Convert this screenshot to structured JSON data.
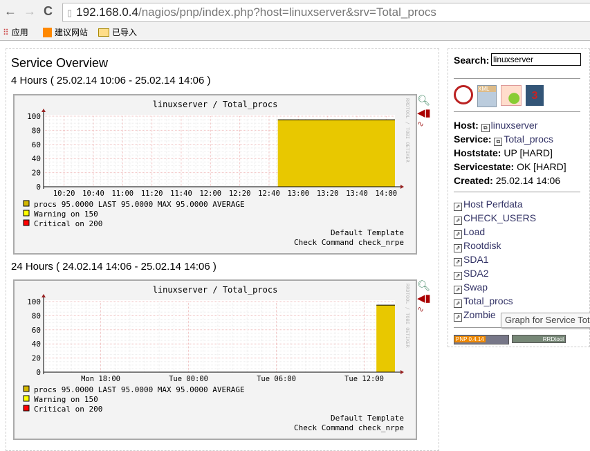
{
  "browser": {
    "url_host": "192.168.0.4",
    "url_path": "/nagios/pnp/index.php?host=linuxserver&srv=Total_procs",
    "bookmarks": [
      {
        "label": "应用",
        "icon": "apps-grid-icon"
      },
      {
        "label": "建议网站",
        "icon": "suggested-sites-icon"
      },
      {
        "label": "已导入",
        "icon": "folder-icon"
      }
    ]
  },
  "main": {
    "title": "Service Overview",
    "periods": [
      {
        "label": "4 Hours ( 25.02.14 10:06 - 25.02.14 14:06 )"
      },
      {
        "label": "24 Hours ( 24.02.14 14:06 - 25.02.14 14:06 )"
      }
    ]
  },
  "chart_data": [
    {
      "type": "area",
      "title": "linuxserver / Total_procs",
      "ylim": [
        0,
        100
      ],
      "yticks": [
        "0",
        "20",
        "40",
        "60",
        "80",
        "100"
      ],
      "xrange": [
        "10:06",
        "14:06"
      ],
      "xticks": [
        "10:20",
        "10:40",
        "11:00",
        "11:20",
        "11:40",
        "12:00",
        "12:20",
        "12:40",
        "13:00",
        "13:20",
        "13:40",
        "14:00"
      ],
      "series": [
        {
          "name": "procs",
          "from": "12:46",
          "to": "14:06",
          "value": 95,
          "color": "#e8c800"
        }
      ],
      "legend": [
        {
          "label": "procs    95.0000  LAST    95.0000  MAX    95.0000  AVERAGE",
          "color": "#d4b800"
        },
        {
          "label": "Warning on  150",
          "color": "#ffff00"
        },
        {
          "label": "Critical on 200",
          "color": "#ff0000"
        }
      ],
      "footer": [
        "Default Template",
        "Check Command check_nrpe"
      ],
      "watermark": "RRDTOOL / TOBI OETIKER"
    },
    {
      "type": "area",
      "title": "linuxserver / Total_procs",
      "ylim": [
        0,
        100
      ],
      "yticks": [
        "0",
        "20",
        "40",
        "60",
        "80",
        "100"
      ],
      "xrange": [
        "Mon 14:06",
        "Tue 14:06"
      ],
      "xticks": [
        "Mon 18:00",
        "Tue 00:00",
        "Tue 06:00",
        "Tue 12:00"
      ],
      "series": [
        {
          "name": "procs",
          "from": "Tue 12:50",
          "to": "Tue 14:06",
          "value": 95,
          "color": "#e8c800"
        }
      ],
      "legend": [
        {
          "label": "procs    95.0000  LAST    95.0000  MAX    95.0000  AVERAGE",
          "color": "#d4b800"
        },
        {
          "label": "Warning on  150",
          "color": "#ffff00"
        },
        {
          "label": "Critical on 200",
          "color": "#ff0000"
        }
      ],
      "footer": [
        "Default Template",
        "Check Command check_nrpe"
      ],
      "watermark": "RRDTOOL / TOBI OETIKER"
    }
  ],
  "sidebar": {
    "search_label": "Search:",
    "search_value": "linuxserver",
    "export_icons": [
      "pdf-icon",
      "xml-icon",
      "chart-icon",
      "calendar-icon"
    ],
    "host_label": "Host:",
    "host": "linuxserver",
    "service_label": "Service:",
    "service": "Total_procs",
    "hoststate_label": "Hoststate:",
    "hoststate": "UP [HARD]",
    "servicestate_label": "Servicestate:",
    "servicestate": "OK [HARD]",
    "created_label": "Created:",
    "created": "25.02.14 14:06",
    "services": [
      "Host Perfdata",
      "CHECK_USERS",
      "Load",
      "Rootdisk",
      "SDA1",
      "SDA2",
      "Swap",
      "Total_procs",
      "Zombie"
    ],
    "badges": [
      "PNP 0.4.14",
      "RRDtool"
    ]
  },
  "tooltip": "Graph for Service Total_procs"
}
